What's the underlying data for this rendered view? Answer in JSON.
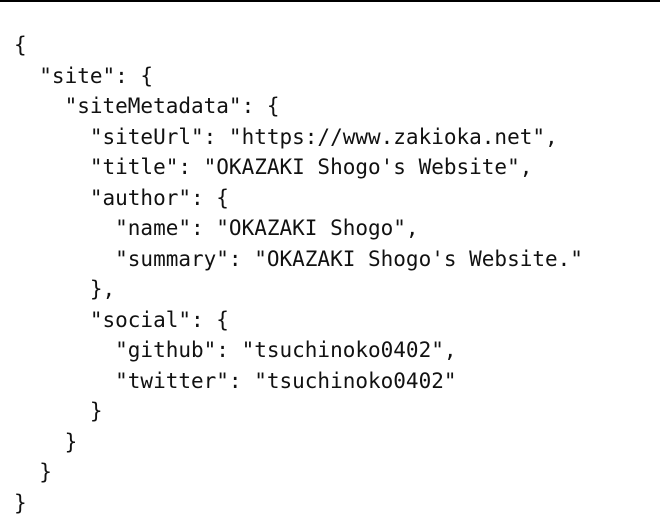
{
  "page": {
    "background": "#ffffff",
    "text_color": "#111111",
    "rule_color": "#000000"
  },
  "code": {
    "lines": [
      "{",
      "  \"site\": {",
      "    \"siteMetadata\": {",
      "      \"siteUrl\": \"https://www.zakioka.net\",",
      "      \"title\": \"OKAZAKI Shogo's Website\",",
      "      \"author\": {",
      "        \"name\": \"OKAZAKI Shogo\",",
      "        \"summary\": \"OKAZAKI Shogo's Website.\"",
      "      },",
      "      \"social\": {",
      "        \"github\": \"tsuchinoko0402\",",
      "        \"twitter\": \"tsuchinoko0402\"",
      "      }",
      "    }",
      "  }",
      "}"
    ]
  }
}
